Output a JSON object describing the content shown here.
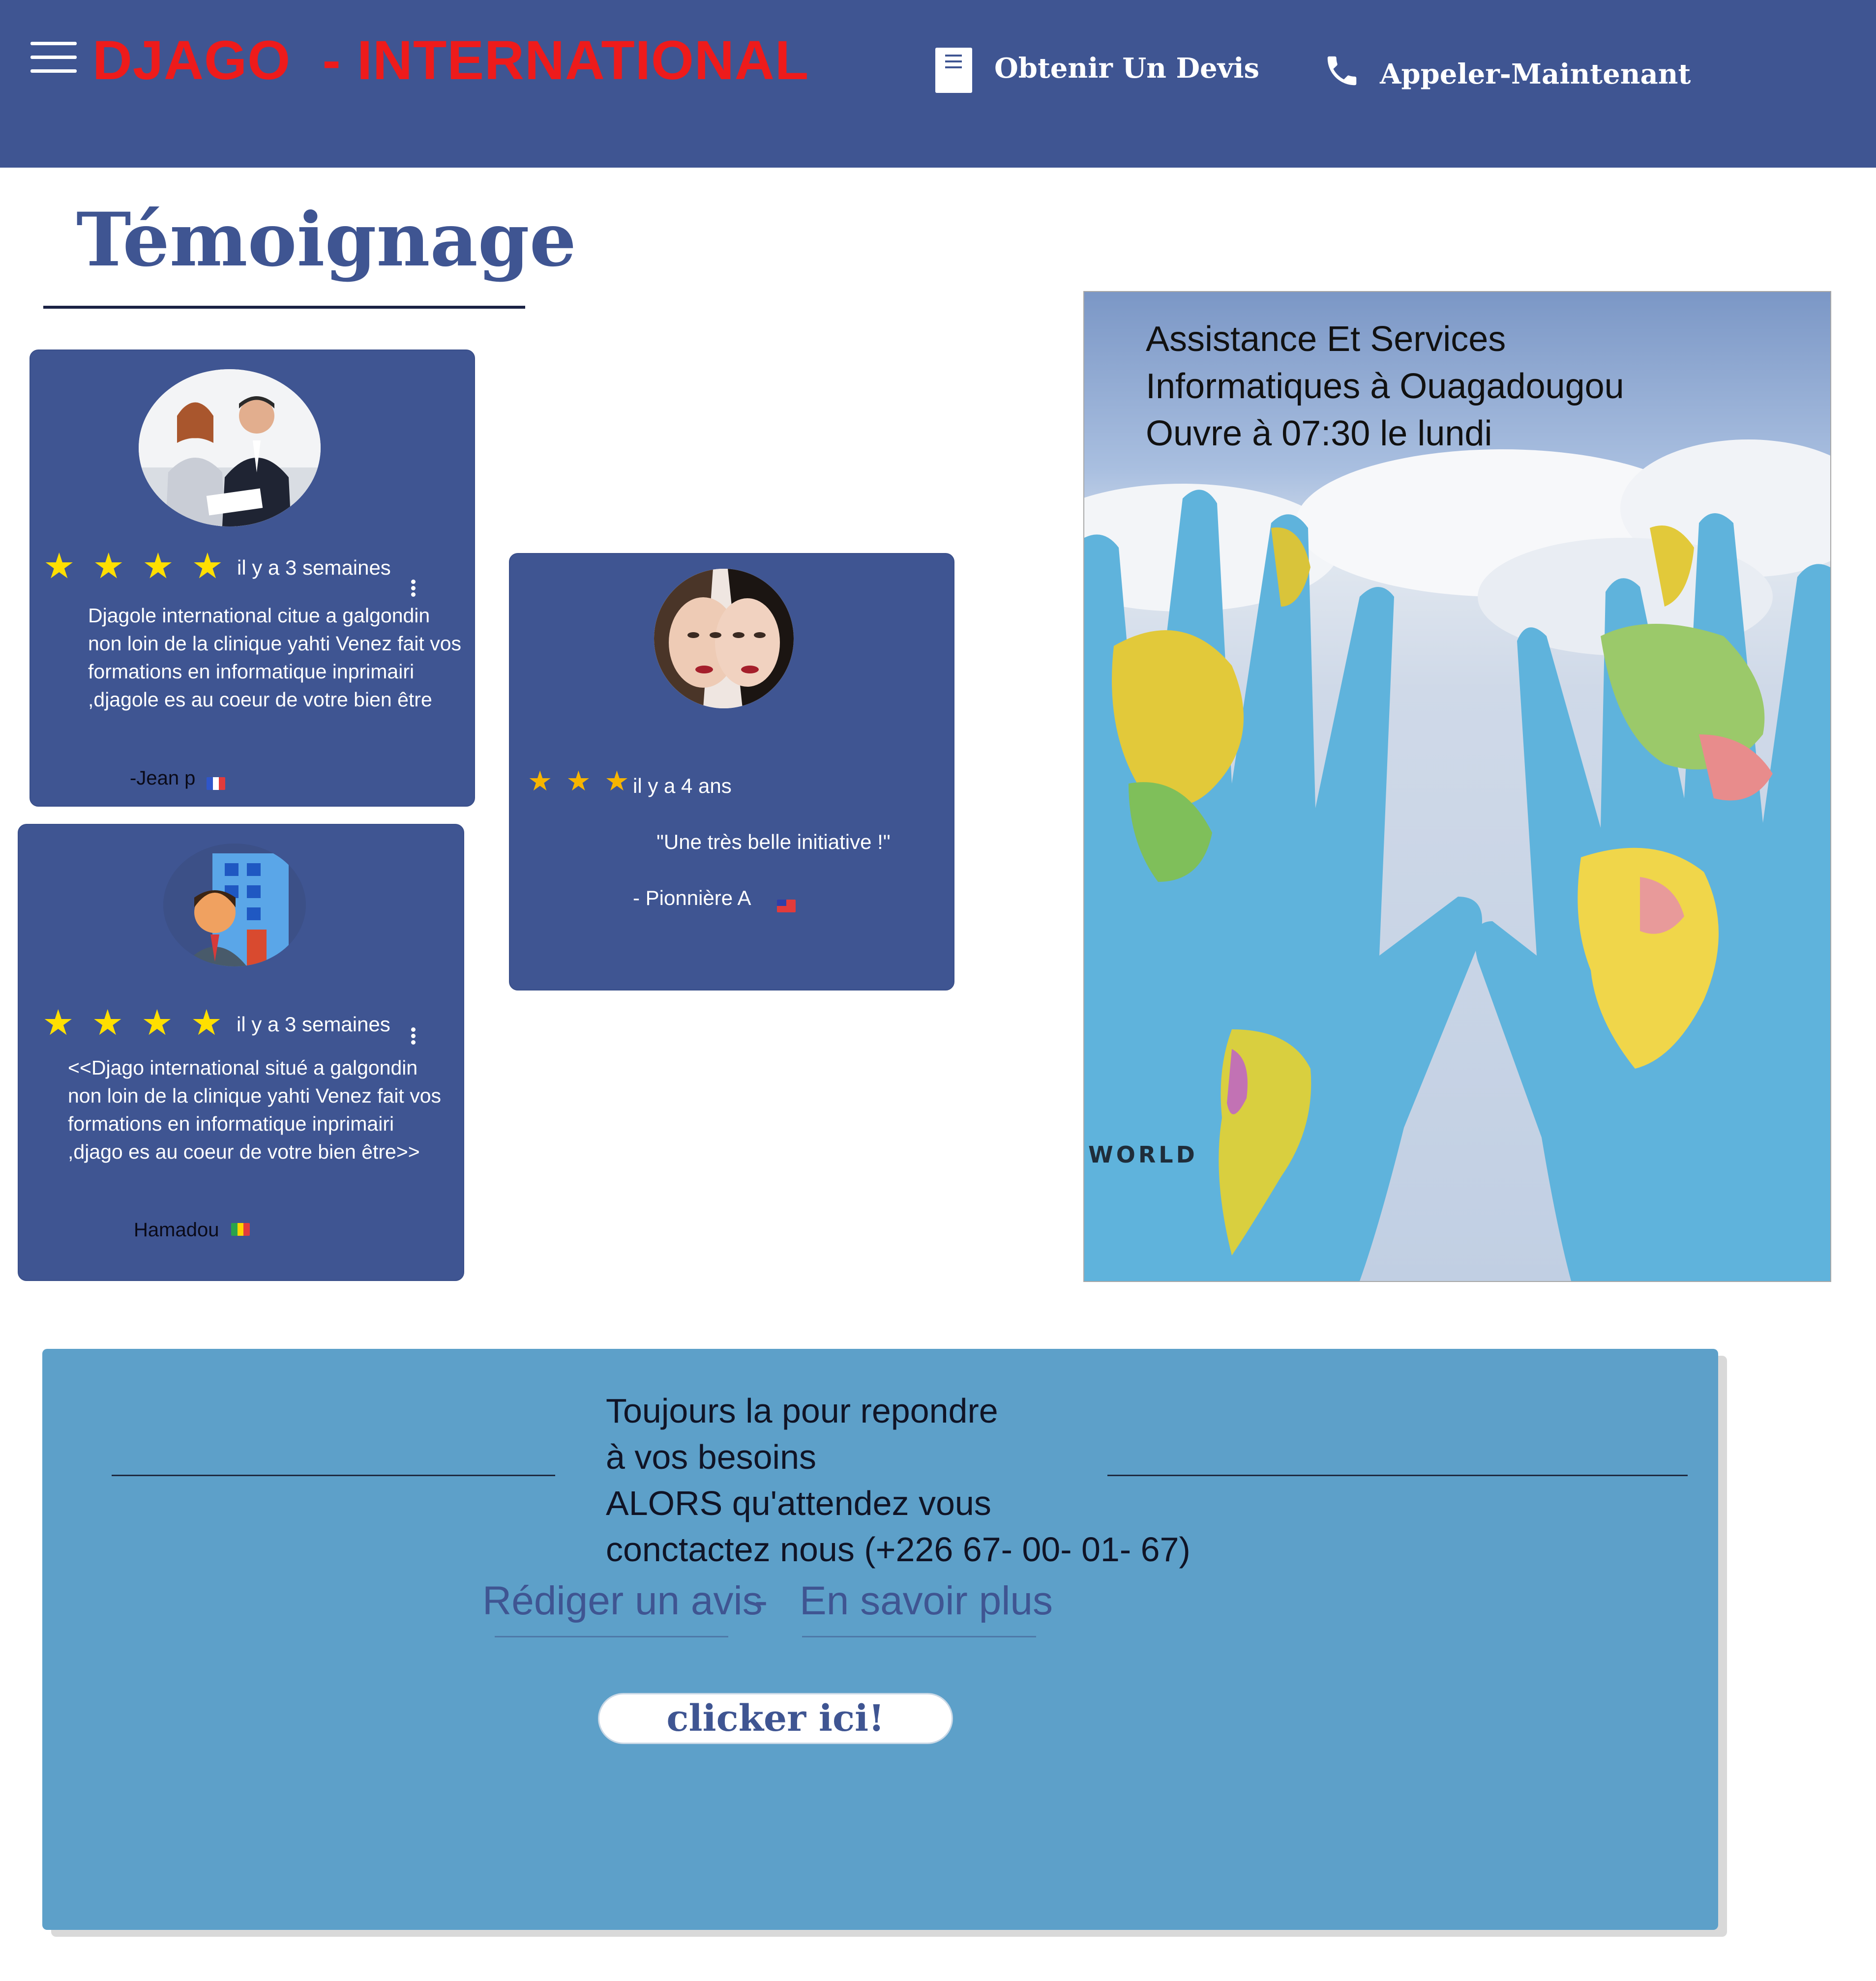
{
  "header": {
    "brand": "DJAGO  - INTERNATIONAL",
    "nav": [
      {
        "label": "Obtenir Un Devis",
        "icon": "document-icon"
      },
      {
        "label": "Appeler-Maintenant",
        "icon": "phone-icon"
      }
    ],
    "menu_icon": "hamburger-menu-icon"
  },
  "section_title": "Témoignage",
  "testimonials": [
    {
      "stars": 4,
      "time": "il y a 3 semaines",
      "text": "Djagole international citue a galgondin non loin de la clinique yahti Venez fait vos formations en informatique inprimairi ,djagole es au coeur de votre bien être",
      "author": "-Jean p",
      "flag": "france-flag"
    },
    {
      "stars": 3,
      "time": "il y a 4 ans",
      "text": "\"Une très belle initiative !\"",
      "author": "- Pionnière A",
      "flag": "taiwan-flag"
    },
    {
      "stars": 4,
      "time": "il y a 3 semaines",
      "text": "<<Djago international situé a galgondin non loin de la clinique yahti Venez fait vos formations en informatique inprimairi ,djago es au coeur de votre bien être>>",
      "author": "Hamadou",
      "flag": "burkina-faso-flag"
    }
  ],
  "hero": {
    "lines": [
      "Assistance Et Services",
      "Informatiques à Ouagadougou",
      "Ouvre à 07:30 le lundi"
    ],
    "image_caption": "WORLD"
  },
  "cta": {
    "line1": "Toujours la pour repondre",
    "line2": " à vos besoins",
    "line3": "ALORS qu'attendez vous",
    "line4": " conctactez nous (+226 67- 00- 01- 67)",
    "link_review": "Rédiger un avis",
    "link_sep": "  - ",
    "link_more": "En savoir plus",
    "button": "clicker ici!"
  },
  "colors": {
    "header_bg": "#3f5592",
    "brand": "#ee1b1b",
    "card_bg": "#3f5592",
    "star": "#ffdf00",
    "cta_bg": "#5da0c9"
  }
}
